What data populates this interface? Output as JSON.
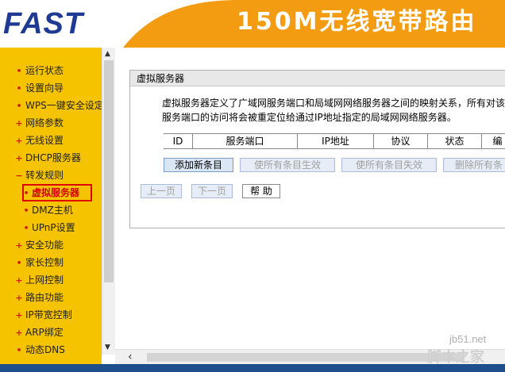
{
  "header": {
    "logo": "FAST",
    "title": "150M无线宽带路由"
  },
  "sidebar": {
    "items": [
      {
        "label": "运行状态",
        "bullet": "•"
      },
      {
        "label": "设置向导",
        "bullet": "•"
      },
      {
        "label": "WPS一键安全设定",
        "bullet": "•"
      },
      {
        "label": "网络参数",
        "bullet": "+"
      },
      {
        "label": "无线设置",
        "bullet": "+"
      },
      {
        "label": "DHCP服务器",
        "bullet": "+"
      },
      {
        "label": "转发规则",
        "bullet": "−"
      },
      {
        "label": "虚拟服务器",
        "bullet": "•"
      },
      {
        "label": "DMZ主机",
        "bullet": "•"
      },
      {
        "label": "UPnP设置",
        "bullet": "•"
      },
      {
        "label": "安全功能",
        "bullet": "+"
      },
      {
        "label": "家长控制",
        "bullet": "•"
      },
      {
        "label": "上网控制",
        "bullet": "+"
      },
      {
        "label": "路由功能",
        "bullet": "+"
      },
      {
        "label": "IP带宽控制",
        "bullet": "+"
      },
      {
        "label": "ARP绑定",
        "bullet": "+"
      },
      {
        "label": "动态DNS",
        "bullet": "•"
      }
    ]
  },
  "panel": {
    "title": "虚拟服务器",
    "desc_line1": "虚拟服务器定义了广域网服务端口和局域网网络服务器之间的映射关系，所有对该",
    "desc_line2": "服务端口的访问将会被重定位给通过IP地址指定的局域网网络服务器。",
    "columns": [
      "ID",
      "服务端口",
      "IP地址",
      "协议",
      "状态",
      "编"
    ]
  },
  "buttons": {
    "add": "添加新条目",
    "enable_all": "使所有条目生效",
    "disable_all": "使所有条目失效",
    "delete_all": "删除所有条",
    "prev": "上一页",
    "next": "下一页",
    "help": "帮 助"
  },
  "watermark": {
    "url": "jb51.net",
    "name": "脚本之家"
  },
  "colors": {
    "accent_orange": "#f39c12",
    "sidebar_yellow": "#f5c300",
    "logo_blue": "#1f3a93",
    "selected_red": "#e00000"
  }
}
